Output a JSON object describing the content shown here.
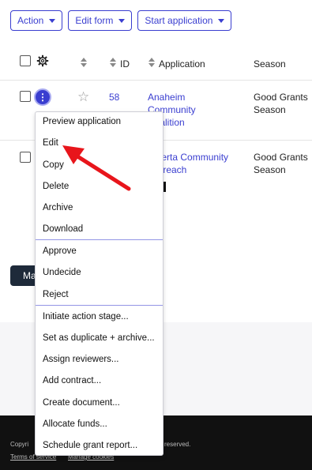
{
  "toolbar": {
    "action_label": "Action",
    "edit_form_label": "Edit form",
    "start_application_label": "Start application"
  },
  "table": {
    "headers": {
      "id": "ID",
      "application": "Application",
      "season": "Season"
    },
    "rows": [
      {
        "id": "58",
        "application_lines": [
          "Anaheim",
          "Community",
          "Coalition"
        ],
        "season_lines": [
          "Good Grants",
          "Season"
        ]
      },
      {
        "application_lines": [
          "Alberta Community",
          "Outreach"
        ],
        "season_lines": [
          "Good Grants",
          "Season"
        ],
        "tag": "d"
      }
    ]
  },
  "bottom_button_label": "Ma",
  "menu": {
    "items": [
      "Preview application",
      "Edit",
      "Copy",
      "Delete",
      "Archive",
      "Download",
      "Approve",
      "Undecide",
      "Reject",
      "Initiate action stage...",
      "Set as duplicate + archive...",
      "Assign reviewers...",
      "Add contract...",
      "Create document...",
      "Allocate funds...",
      "Schedule grant report..."
    ]
  },
  "footer": {
    "copyright_prefix": "Copyri",
    "copyright_suffix": "reserved.",
    "terms": "Terms of service",
    "cookies": "Manage cookies"
  },
  "colors": {
    "accent": "#3a3ed0",
    "annotation": "#e8151b",
    "footer_bg": "#111111"
  }
}
